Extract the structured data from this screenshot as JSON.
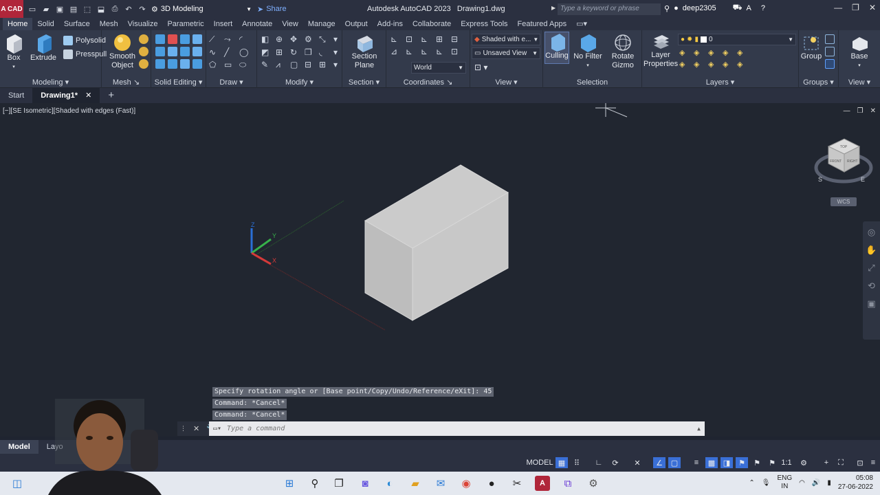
{
  "titlebar": {
    "logo": "A CAD",
    "workspace": "3D Modeling",
    "share": "Share",
    "app_title": "Autodesk AutoCAD 2023",
    "doc_title": "Drawing1.dwg",
    "search_placeholder": "Type a keyword or phrase",
    "user": "deep2305"
  },
  "ribbon_tabs": [
    "Home",
    "Solid",
    "Surface",
    "Mesh",
    "Visualize",
    "Parametric",
    "Insert",
    "Annotate",
    "View",
    "Manage",
    "Output",
    "Add-ins",
    "Collaborate",
    "Express Tools",
    "Featured Apps"
  ],
  "ribbon": {
    "modeling": {
      "label": "Modeling",
      "box": "Box",
      "extrude": "Extrude",
      "polysolid": "Polysolid",
      "presspull": "Presspull"
    },
    "mesh": {
      "label": "Mesh",
      "smooth": "Smooth",
      "object": "Object"
    },
    "solid_editing": {
      "label": "Solid Editing"
    },
    "draw": {
      "label": "Draw"
    },
    "modify": {
      "label": "Modify"
    },
    "section": {
      "label": "Section",
      "section": "Section",
      "plane": "Plane"
    },
    "coordinates": {
      "label": "Coordinates",
      "ucs": "World"
    },
    "view": {
      "label": "View",
      "visual_style": "Shaded with e...",
      "named_view": "Unsaved View"
    },
    "selection": {
      "label": "Selection",
      "culling": "Culling",
      "filter": "No Filter",
      "rotate": "Rotate",
      "gizmo": "Gizmo"
    },
    "layers": {
      "label": "Layers",
      "props1": "Layer",
      "props2": "Properties",
      "current": "0"
    },
    "groups": {
      "label": "Groups",
      "group": "Group"
    },
    "viewp": {
      "label": "View",
      "base": "Base"
    }
  },
  "doc_tabs": [
    "Start",
    "Drawing1*"
  ],
  "viewport": {
    "label": "[−][SE Isometric][Shaded with edges (Fast)]",
    "cube_top": "TOP",
    "cube_front": "FRONT",
    "cube_right": "RIGHT",
    "compass_s": "S",
    "compass_e": "E",
    "wcs": "WCS",
    "axis_x": "X",
    "axis_y": "Y",
    "axis_z": "Z"
  },
  "command": {
    "history": [
      "Specify rotation angle or [Base point/Copy/Undo/Reference/eXit]: 45",
      "Command: *Cancel*",
      "Command: *Cancel*"
    ],
    "placeholder": "Type a command"
  },
  "layout_tabs": [
    "Model",
    "Layo"
  ],
  "status": {
    "model": "MODEL",
    "scale": "1:1"
  },
  "tray": {
    "lang1": "ENG",
    "lang2": "IN",
    "time": "05:08",
    "date": "27-06-2022"
  },
  "colors": {
    "accent": "#b0263a",
    "ribbon": "#333a4b",
    "viewport": "#212630"
  }
}
